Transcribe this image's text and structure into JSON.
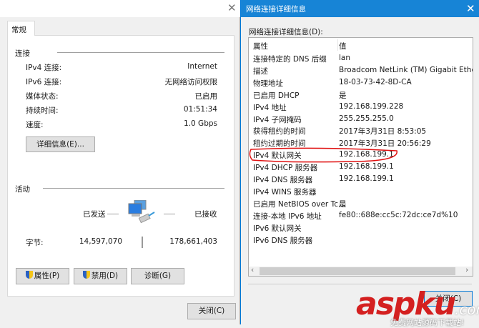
{
  "status_dialog": {
    "tab": "常规",
    "connection_heading": "连接",
    "rows": [
      {
        "label": "IPv4 连接:",
        "value": "Internet"
      },
      {
        "label": "IPv6 连接:",
        "value": "无网络访问权限"
      },
      {
        "label": "媒体状态:",
        "value": "已启用"
      },
      {
        "label": "持续时间:",
        "value": "01:51:34"
      },
      {
        "label": "速度:",
        "value": "1.0 Gbps"
      }
    ],
    "details_button": "详细信息(E)...",
    "activity_heading": "活动",
    "sent_label": "已发送",
    "received_label": "已接收",
    "bytes_label": "字节:",
    "bytes_sent": "14,597,070",
    "bytes_received": "178,661,403",
    "properties_button": "属性(P)",
    "disable_button": "禁用(D)",
    "diagnose_button": "诊断(G)",
    "close_button": "关闭(C)"
  },
  "details_dialog": {
    "title": "网络连接详细信息",
    "list_label": "网络连接详细信息(D):",
    "col_property": "属性",
    "col_value": "值",
    "rows": [
      {
        "p": "连接特定的 DNS 后缀",
        "v": "lan"
      },
      {
        "p": "描述",
        "v": "Broadcom NetLink (TM) Gigabit Ethernet"
      },
      {
        "p": "物理地址",
        "v": "18-03-73-42-8D-CA"
      },
      {
        "p": "已启用 DHCP",
        "v": "是"
      },
      {
        "p": "IPv4 地址",
        "v": "192.168.199.228"
      },
      {
        "p": "IPv4 子网掩码",
        "v": "255.255.255.0"
      },
      {
        "p": "获得租约的时间",
        "v": "2017年3月31日 8:53:05"
      },
      {
        "p": "租约过期的时间",
        "v": "2017年3月31日 20:56:29"
      },
      {
        "p": "IPv4 默认网关",
        "v": "192.168.199.1"
      },
      {
        "p": "IPv4 DHCP 服务器",
        "v": "192.168.199.1"
      },
      {
        "p": "IPv4 DNS 服务器",
        "v": "192.168.199.1"
      },
      {
        "p": "IPv4 WINS 服务器",
        "v": ""
      },
      {
        "p": "已启用 NetBIOS over Tc...",
        "v": "是"
      },
      {
        "p": "连接-本地 IPv6 地址",
        "v": "fe80::688e:cc5c:72dc:ce7d%10"
      },
      {
        "p": "IPv6 默认网关",
        "v": ""
      },
      {
        "p": "IPv6 DNS 服务器",
        "v": ""
      }
    ],
    "close_button": "关闭(C)",
    "highlight_color": "#e01010"
  },
  "watermark": {
    "brand": "aspku",
    "domain": ".com",
    "slogan": "免费网站源码下载站!"
  }
}
